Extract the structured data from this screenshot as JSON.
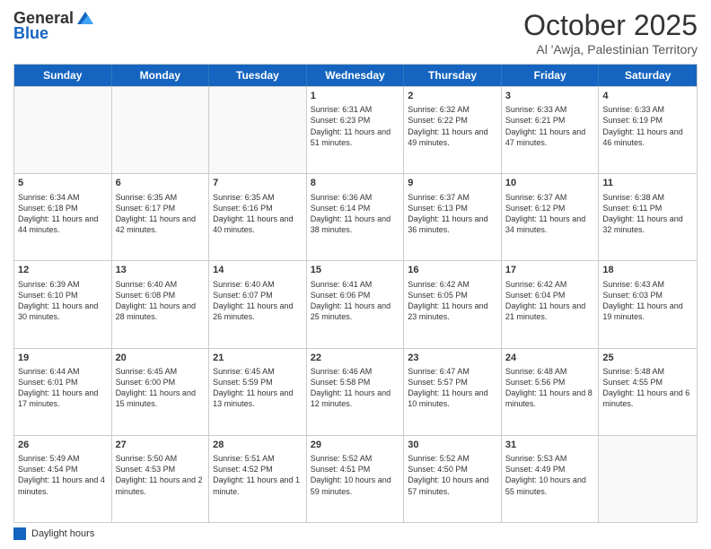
{
  "header": {
    "logo_general": "General",
    "logo_blue": "Blue",
    "month_title": "October 2025",
    "location": "Al 'Awja, Palestinian Territory"
  },
  "weekdays": [
    "Sunday",
    "Monday",
    "Tuesday",
    "Wednesday",
    "Thursday",
    "Friday",
    "Saturday"
  ],
  "footer": {
    "label": "Daylight hours"
  },
  "rows": [
    [
      {
        "day": "",
        "info": ""
      },
      {
        "day": "",
        "info": ""
      },
      {
        "day": "",
        "info": ""
      },
      {
        "day": "1",
        "info": "Sunrise: 6:31 AM\nSunset: 6:23 PM\nDaylight: 11 hours and 51 minutes."
      },
      {
        "day": "2",
        "info": "Sunrise: 6:32 AM\nSunset: 6:22 PM\nDaylight: 11 hours and 49 minutes."
      },
      {
        "day": "3",
        "info": "Sunrise: 6:33 AM\nSunset: 6:21 PM\nDaylight: 11 hours and 47 minutes."
      },
      {
        "day": "4",
        "info": "Sunrise: 6:33 AM\nSunset: 6:19 PM\nDaylight: 11 hours and 46 minutes."
      }
    ],
    [
      {
        "day": "5",
        "info": "Sunrise: 6:34 AM\nSunset: 6:18 PM\nDaylight: 11 hours and 44 minutes."
      },
      {
        "day": "6",
        "info": "Sunrise: 6:35 AM\nSunset: 6:17 PM\nDaylight: 11 hours and 42 minutes."
      },
      {
        "day": "7",
        "info": "Sunrise: 6:35 AM\nSunset: 6:16 PM\nDaylight: 11 hours and 40 minutes."
      },
      {
        "day": "8",
        "info": "Sunrise: 6:36 AM\nSunset: 6:14 PM\nDaylight: 11 hours and 38 minutes."
      },
      {
        "day": "9",
        "info": "Sunrise: 6:37 AM\nSunset: 6:13 PM\nDaylight: 11 hours and 36 minutes."
      },
      {
        "day": "10",
        "info": "Sunrise: 6:37 AM\nSunset: 6:12 PM\nDaylight: 11 hours and 34 minutes."
      },
      {
        "day": "11",
        "info": "Sunrise: 6:38 AM\nSunset: 6:11 PM\nDaylight: 11 hours and 32 minutes."
      }
    ],
    [
      {
        "day": "12",
        "info": "Sunrise: 6:39 AM\nSunset: 6:10 PM\nDaylight: 11 hours and 30 minutes."
      },
      {
        "day": "13",
        "info": "Sunrise: 6:40 AM\nSunset: 6:08 PM\nDaylight: 11 hours and 28 minutes."
      },
      {
        "day": "14",
        "info": "Sunrise: 6:40 AM\nSunset: 6:07 PM\nDaylight: 11 hours and 26 minutes."
      },
      {
        "day": "15",
        "info": "Sunrise: 6:41 AM\nSunset: 6:06 PM\nDaylight: 11 hours and 25 minutes."
      },
      {
        "day": "16",
        "info": "Sunrise: 6:42 AM\nSunset: 6:05 PM\nDaylight: 11 hours and 23 minutes."
      },
      {
        "day": "17",
        "info": "Sunrise: 6:42 AM\nSunset: 6:04 PM\nDaylight: 11 hours and 21 minutes."
      },
      {
        "day": "18",
        "info": "Sunrise: 6:43 AM\nSunset: 6:03 PM\nDaylight: 11 hours and 19 minutes."
      }
    ],
    [
      {
        "day": "19",
        "info": "Sunrise: 6:44 AM\nSunset: 6:01 PM\nDaylight: 11 hours and 17 minutes."
      },
      {
        "day": "20",
        "info": "Sunrise: 6:45 AM\nSunset: 6:00 PM\nDaylight: 11 hours and 15 minutes."
      },
      {
        "day": "21",
        "info": "Sunrise: 6:45 AM\nSunset: 5:59 PM\nDaylight: 11 hours and 13 minutes."
      },
      {
        "day": "22",
        "info": "Sunrise: 6:46 AM\nSunset: 5:58 PM\nDaylight: 11 hours and 12 minutes."
      },
      {
        "day": "23",
        "info": "Sunrise: 6:47 AM\nSunset: 5:57 PM\nDaylight: 11 hours and 10 minutes."
      },
      {
        "day": "24",
        "info": "Sunrise: 6:48 AM\nSunset: 5:56 PM\nDaylight: 11 hours and 8 minutes."
      },
      {
        "day": "25",
        "info": "Sunrise: 5:48 AM\nSunset: 4:55 PM\nDaylight: 11 hours and 6 minutes."
      }
    ],
    [
      {
        "day": "26",
        "info": "Sunrise: 5:49 AM\nSunset: 4:54 PM\nDaylight: 11 hours and 4 minutes."
      },
      {
        "day": "27",
        "info": "Sunrise: 5:50 AM\nSunset: 4:53 PM\nDaylight: 11 hours and 2 minutes."
      },
      {
        "day": "28",
        "info": "Sunrise: 5:51 AM\nSunset: 4:52 PM\nDaylight: 11 hours and 1 minute."
      },
      {
        "day": "29",
        "info": "Sunrise: 5:52 AM\nSunset: 4:51 PM\nDaylight: 10 hours and 59 minutes."
      },
      {
        "day": "30",
        "info": "Sunrise: 5:52 AM\nSunset: 4:50 PM\nDaylight: 10 hours and 57 minutes."
      },
      {
        "day": "31",
        "info": "Sunrise: 5:53 AM\nSunset: 4:49 PM\nDaylight: 10 hours and 55 minutes."
      },
      {
        "day": "",
        "info": ""
      }
    ]
  ]
}
